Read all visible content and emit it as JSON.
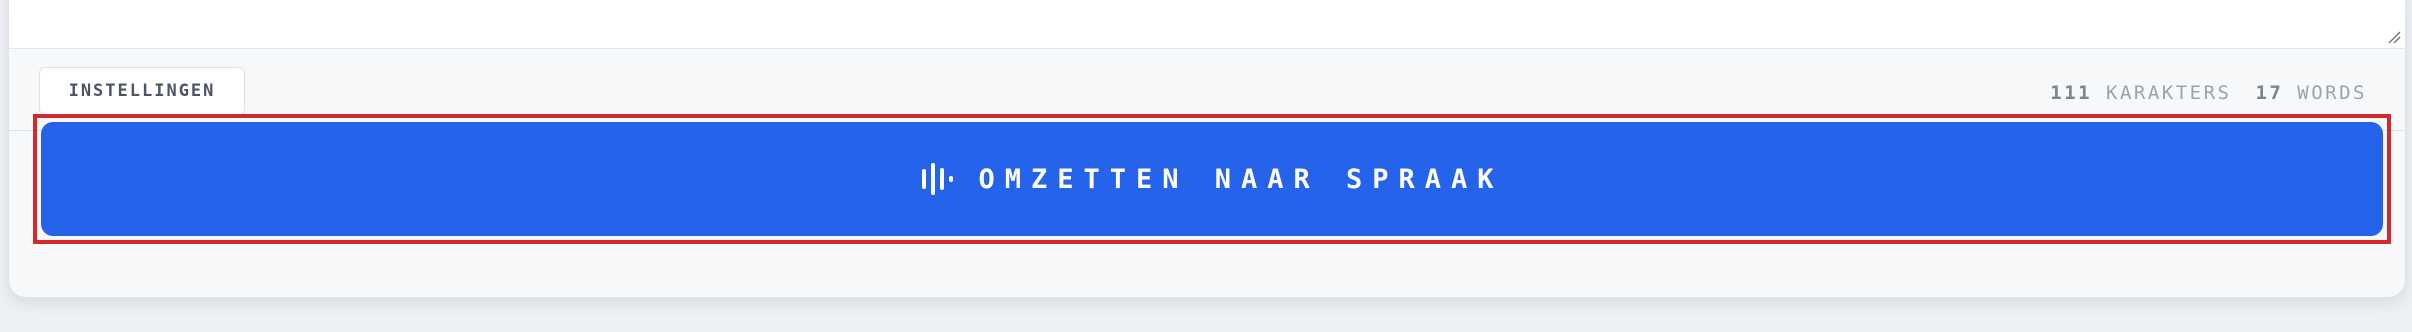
{
  "toolbar": {
    "settings_label": "INSTELLINGEN",
    "char_count": "111",
    "char_label": "KARAKTERS",
    "word_count": "17",
    "word_label": "WORDS"
  },
  "convert": {
    "label": "OMZETTEN NAAR SPRAAK",
    "icon": "audio-waveform-icon",
    "color": "#2563eb",
    "highlight_color": "#d42a2f"
  }
}
